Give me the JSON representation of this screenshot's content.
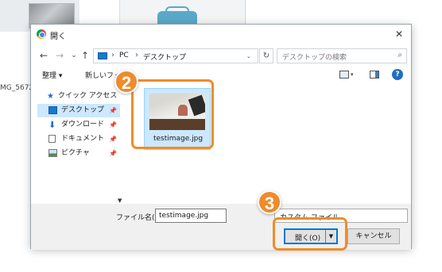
{
  "background": {
    "filename_partial": "MG_5672."
  },
  "dialog": {
    "title": "開く",
    "close_label": "✕",
    "nav": {
      "back_icon": "←",
      "forward_icon": "→",
      "dropdown_icon": "⌄",
      "up_icon": "↑",
      "breadcrumb": [
        "PC",
        "デスクトップ"
      ],
      "refresh_icon": "↻",
      "search_placeholder": "デスクトップの検索",
      "search_icon": "⌕"
    },
    "toolbar": {
      "organize": "整理 ▾",
      "new_folder": "新しいフォル"
    },
    "sidebar": {
      "items": [
        {
          "label": "クイック アクセス"
        },
        {
          "label": "デスクトップ",
          "selected": true,
          "pinned": true
        },
        {
          "label": "ダウンロード",
          "pinned": true
        },
        {
          "label": "ドキュメント",
          "pinned": true
        },
        {
          "label": "ピクチャ",
          "pinned": true
        }
      ]
    },
    "files": [
      {
        "name": "testimage.jpg",
        "selected": true
      }
    ],
    "bottom": {
      "filename_label": "ファイル名(N):",
      "filename_value": "testimage.jpg",
      "filetype_value": "カスタム ファイル",
      "open_label": "開く(O)",
      "cancel_label": "キャンセル"
    }
  },
  "annotations": {
    "step_a": "2",
    "step_b": "3",
    "accent_color": "#f08c2a"
  }
}
